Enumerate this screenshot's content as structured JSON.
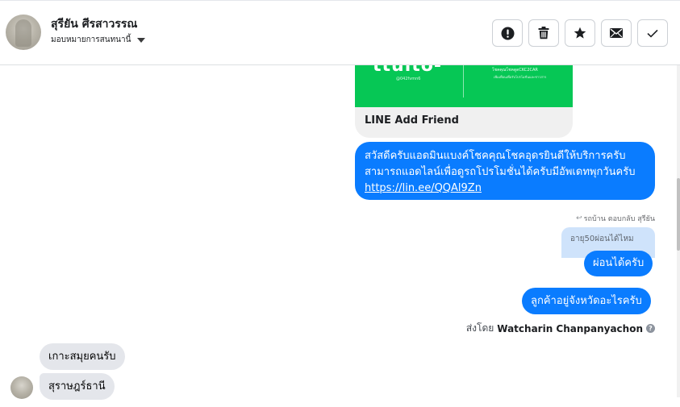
{
  "header": {
    "contact_name": "สุรียัน ศีรสาวรรณ",
    "assign_label": "มอบหมายการสนทนานี้",
    "actions": [
      {
        "name": "spam-button",
        "icon": "exclamation-icon"
      },
      {
        "name": "delete-button",
        "icon": "trash-icon"
      },
      {
        "name": "star-button",
        "icon": "star-icon"
      },
      {
        "name": "mark-unread-button",
        "icon": "envelope-icon"
      },
      {
        "name": "mark-done-button",
        "icon": "checkmark-icon"
      }
    ]
  },
  "card": {
    "image_text": "ttulto-",
    "image_handle": "@042fvmn6",
    "image_right_title": "โชคคุณโชคดูดCKC2CAR",
    "image_right_sub": "เพิ่มเพื่อนเพื่อรับโปรโมชั่นและข่าวสาร",
    "title": "LINE Add Friend"
  },
  "messages": {
    "promo_line1": "สวัสดีครับแอดมินแบงค์โชคคุณโชคอุดรยินดีให้บริการครับ",
    "promo_line2": "สามารถแอดไลน์เพื่อดูรถโปรโมชั่นได้ครับมีอัพเดทพุกวันครับ",
    "promo_link": "https://lin.ee/QQAl9Zn",
    "reply_meta": "รถบ้าน ตอบกลับ สุรียัน",
    "quoted_text": "อายุ50ผ่อนได้ไหม",
    "reply_text": "ผ่อนได้ครับ",
    "province_question": "ลูกค้าอยู่จังหวัดอะไรครับ",
    "sent_by_prefix": "ส่งโดย",
    "sent_by_name": "Watcharin Chanpanyachon",
    "incoming_1": "เกาะสมุยคนรับ",
    "incoming_2": "สุราษฎร์ธานี"
  },
  "colors": {
    "outgoing_bubble": "#0a7cff",
    "incoming_bubble": "#e4e6eb",
    "line_green": "#06c755",
    "quoted_bg": "#cfe3fb"
  }
}
